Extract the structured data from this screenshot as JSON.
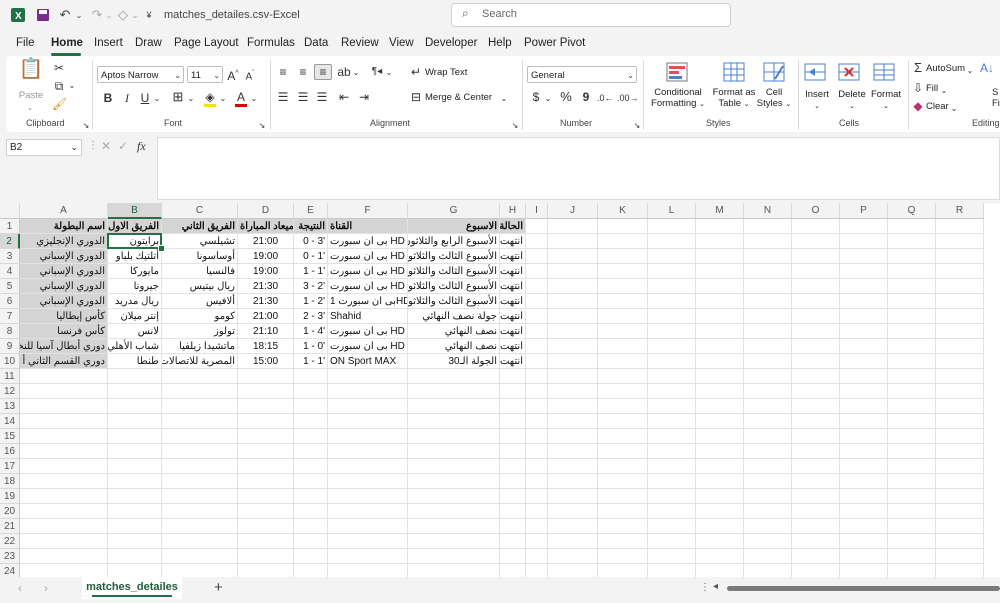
{
  "title": {
    "filename": "matches_detailes.csv",
    "separator": " - ",
    "app": "Excel",
    "search_placeholder": "Search"
  },
  "menu": [
    "File",
    "Home",
    "Insert",
    "Draw",
    "Page Layout",
    "Formulas",
    "Data",
    "Review",
    "View",
    "Developer",
    "Help",
    "Power Pivot"
  ],
  "ribbon": {
    "clipboard": {
      "label": "Clipboard",
      "paste": "Paste"
    },
    "font": {
      "label": "Font",
      "name": "Aptos Narrow",
      "size": "11"
    },
    "alignment": {
      "label": "Alignment",
      "wrap_text": "Wrap Text",
      "merge_center": "Merge & Center"
    },
    "number": {
      "label": "Number",
      "format": "General",
      "currency": "$",
      "percent": "%",
      "comma": "9"
    },
    "styles": {
      "label": "Styles",
      "conditional_1": "Conditional",
      "conditional_2": "Formatting",
      "format_table_1": "Format as",
      "format_table_2": "Table",
      "cell_styles_1": "Cell",
      "cell_styles_2": "Styles"
    },
    "cells": {
      "label": "Cells",
      "insert": "Insert",
      "delete": "Delete",
      "format": "Format"
    },
    "editing": {
      "label": "Editing",
      "autosum": "AutoSum",
      "fill": "Fill",
      "clear": "Clear",
      "sort_1": "S",
      "sort_2": "Fi"
    }
  },
  "formula_bar": {
    "name_box": "B2",
    "fx": "fx",
    "content": ""
  },
  "grid": {
    "columns": [
      "A",
      "B",
      "C",
      "D",
      "E",
      "F",
      "G",
      "H",
      "I",
      "J",
      "K",
      "L",
      "M",
      "N",
      "O",
      "P",
      "Q",
      "R"
    ],
    "row_numbers": [
      "1",
      "2",
      "3",
      "4",
      "5",
      "6",
      "7",
      "8",
      "9",
      "10",
      "11",
      "12",
      "13",
      "14",
      "15",
      "16",
      "17",
      "18",
      "19",
      "20",
      "21",
      "22",
      "23",
      "24"
    ],
    "selected_cell": "B2",
    "rows": [
      [
        "اسم البطولة",
        "الفريق الاول",
        "الفريق الثاني",
        "ميعاد المباراة",
        "النتيجة",
        "القناة",
        "الاسبوع",
        "الحالة"
      ],
      [
        "الدوري الإنجليزي",
        "برايتون",
        "تشيلسي",
        "21:00",
        "'3 - 0",
        "بى ان سبورت HD 3",
        "الأسبوع الرابع والثلاثون",
        "انتهت"
      ],
      [
        "الدوري الإسباني",
        "أتلتيك بلباو",
        "أوساسونا",
        "19:00",
        "'1 - 0",
        "بى ان سبورت HD 5",
        "الأسبوع الثالث والثلاثون",
        "انتهت"
      ],
      [
        "الدوري الإسباني",
        "مايوركا",
        "فالنسيا",
        "19:00",
        "'1 - 1",
        "بى ان سبورت HD 6",
        "الأسبوع الثالث والثلاثون",
        "انتهت"
      ],
      [
        "الدوري الإسباني",
        "جيرونا",
        "ريال بيتيس",
        "21:30",
        "'2 - 3",
        "بى ان سبورت HD 5",
        "الأسبوع الثالث والثلاثون",
        "انتهت"
      ],
      [
        "الدوري الإسباني",
        "ريال مدريد",
        "ألافيس",
        "21:30",
        "'2 - 1",
        "بى ان سبورت 1HD",
        "الأسبوع الثالث والثلاثون",
        "انتهت"
      ],
      [
        "كأس إيطاليا",
        "إنتر ميلان",
        "كومو",
        "21:00",
        "'3 - 2",
        "Shahid",
        "جولة نصف النهائي",
        "انتهت"
      ],
      [
        "كأس فرنسا",
        "لانس",
        "تولوز",
        "21:10",
        "'4 - 1",
        "بى ان سبورت HD 4",
        "نصف النهائي",
        "انتهت"
      ],
      [
        "دوري أبطال آسيا للنخبة",
        "شباب الأهلي",
        "ماتشيدا زيلفيا",
        "18:15",
        "'0 - 1",
        "بى ان سبورت HD 2",
        "نصف النهائي",
        "انتهت"
      ],
      [
        "دوري القسم الثاني أ",
        "طنطا",
        "المصرية للاتصالات",
        "15:00",
        "'1 - 1",
        "ON Sport MAX",
        "الجولة الـ30",
        "انتهت"
      ]
    ]
  },
  "sheet_tabs": {
    "active": "matches_detailes",
    "add": "+"
  }
}
